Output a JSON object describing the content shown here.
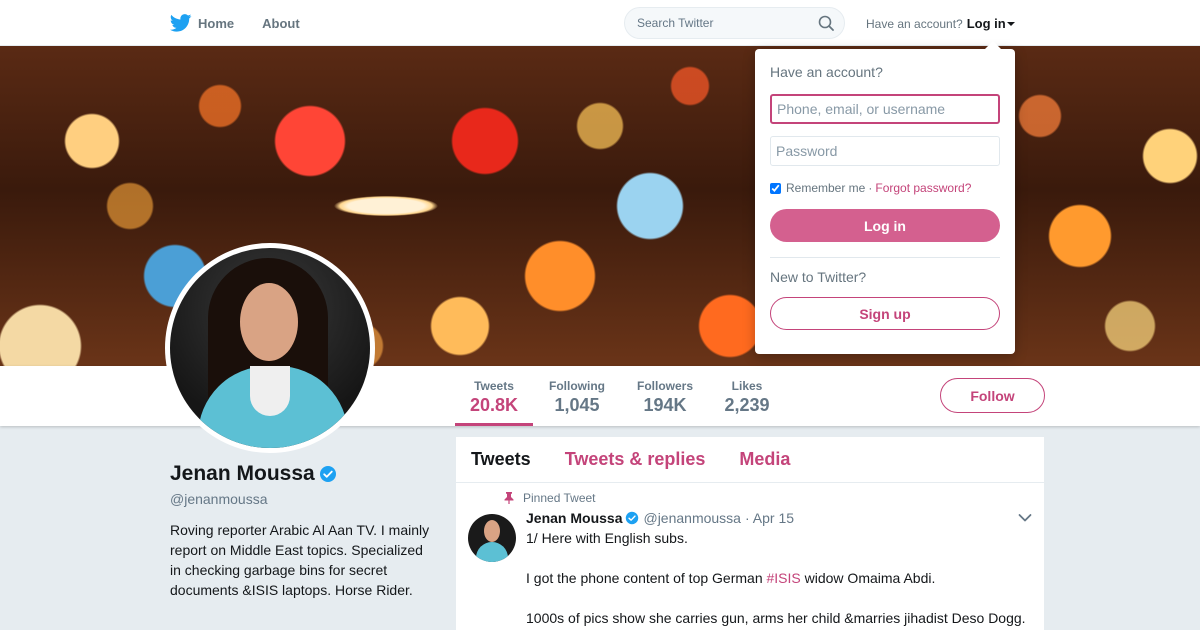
{
  "nav": {
    "home_label": "Home",
    "about_label": "About",
    "search_placeholder": "Search Twitter",
    "have_account": "Have an account?",
    "login_label": "Log in"
  },
  "login_dropdown": {
    "title": "Have an account?",
    "username_placeholder": "Phone, email, or username",
    "password_placeholder": "Password",
    "remember_me": "Remember me",
    "separator": "·",
    "forgot_password": "Forgot password?",
    "login_button": "Log in",
    "new_to_twitter": "New to Twitter?",
    "signup_button": "Sign up"
  },
  "profile_nav": {
    "stats": [
      {
        "label": "Tweets",
        "value": "20.8K"
      },
      {
        "label": "Following",
        "value": "1,045"
      },
      {
        "label": "Followers",
        "value": "194K"
      },
      {
        "label": "Likes",
        "value": "2,239"
      }
    ],
    "follow_button": "Follow"
  },
  "profile": {
    "name": "Jenan Moussa",
    "handle": "@jenanmoussa",
    "bio": "Roving reporter Arabic Al Aan TV. I mainly report on Middle East topics. Specialized in checking garbage bins for secret documents &ISIS laptops. Horse Rider."
  },
  "timeline": {
    "tabs": [
      "Tweets",
      "Tweets & replies",
      "Media"
    ],
    "tweet": {
      "pinned_label": "Pinned Tweet",
      "author": "Jenan Moussa",
      "handle": "@jenanmoussa",
      "date": "· Apr 15",
      "line1": "1/ Here with English subs.",
      "line2_before": "I got the phone content of top German ",
      "line2_hashtag": "#ISIS",
      "line2_after": " widow Omaima Abdi.",
      "line3": "1000s of pics show she carries gun, arms her child &marries jihadist Deso Dogg."
    }
  },
  "colors": {
    "accent": "#c4447a",
    "twitter_blue": "#1da1f2",
    "background": "#e6ecf0"
  }
}
